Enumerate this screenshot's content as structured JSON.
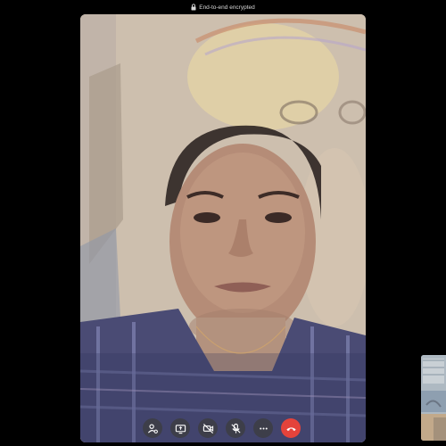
{
  "header": {
    "encryption_label": "End-to-end encrypted",
    "lock_icon": "lock-icon"
  },
  "controls": [
    {
      "name": "participants-button",
      "icon": "person-settings-icon"
    },
    {
      "name": "share-screen-button",
      "icon": "screen-share-icon"
    },
    {
      "name": "camera-off-button",
      "icon": "video-off-icon"
    },
    {
      "name": "mute-button",
      "icon": "mic-off-icon"
    },
    {
      "name": "more-options-button",
      "icon": "more-dots-icon"
    },
    {
      "name": "end-call-button",
      "icon": "phone-hangup-icon"
    }
  ],
  "colors": {
    "background": "#000000",
    "end_call": "#e4433b",
    "control_bg": "#3c3c3c"
  }
}
